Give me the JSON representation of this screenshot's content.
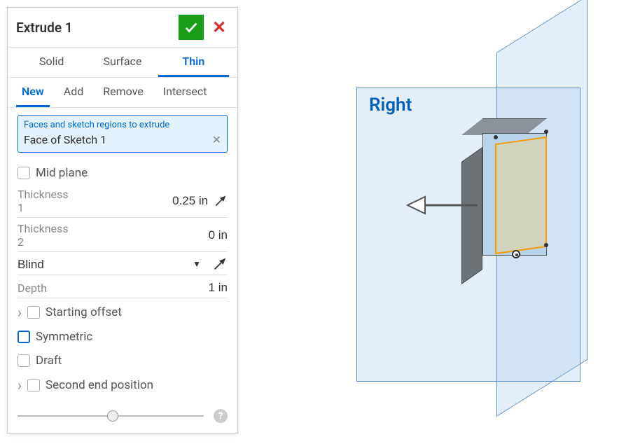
{
  "panel": {
    "title": "Extrude 1",
    "top_tabs": [
      "Solid",
      "Surface",
      "Thin"
    ],
    "top_active_index": 2,
    "sub_tabs": [
      "New",
      "Add",
      "Remove",
      "Intersect"
    ],
    "sub_active_index": 0,
    "selection": {
      "label": "Faces and sketch regions to extrude",
      "chip": "Face of Sketch 1"
    },
    "options": {
      "mid_plane": {
        "label": "Mid plane",
        "checked": false
      },
      "thickness1": {
        "label": "Thickness 1",
        "value": "0.25 in"
      },
      "thickness2": {
        "label": "Thickness 2",
        "value": "0 in"
      },
      "end_type": {
        "value": "Blind"
      },
      "depth": {
        "label": "Depth",
        "value": "1 in"
      },
      "starting_offset": {
        "label": "Starting offset",
        "checked": false
      },
      "symmetric": {
        "label": "Symmetric",
        "checked": false,
        "highlighted": true
      },
      "draft": {
        "label": "Draft",
        "checked": false
      },
      "second_end": {
        "label": "Second end position",
        "checked": false
      }
    }
  },
  "viewport": {
    "plane_label": "Right"
  }
}
